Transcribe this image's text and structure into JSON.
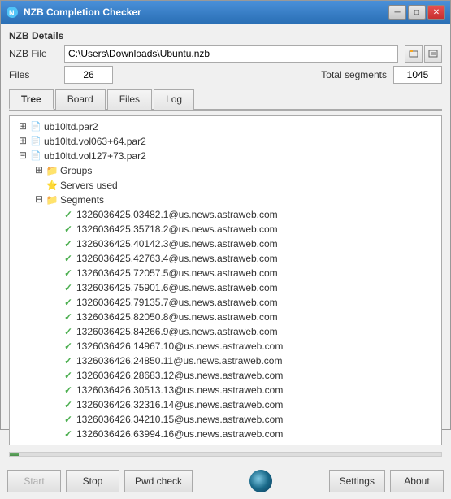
{
  "window": {
    "title": "NZB Completion Checker",
    "title_buttons": {
      "minimize": "─",
      "maximize": "□",
      "close": "✕"
    }
  },
  "details": {
    "section_label": "NZB Details",
    "nzb_file_label": "NZB File",
    "nzb_file_value": "C:\\Users\\Downloads\\Ubuntu.nzb",
    "files_label": "Files",
    "files_value": "26",
    "segments_label": "Total segments",
    "segments_value": "1045"
  },
  "tabs": [
    {
      "id": "tree",
      "label": "Tree",
      "active": true
    },
    {
      "id": "board",
      "label": "Board",
      "active": false
    },
    {
      "id": "files",
      "label": "Files",
      "active": false
    },
    {
      "id": "log",
      "label": "Log",
      "active": false
    }
  ],
  "tree": {
    "items": [
      {
        "indent": 0,
        "toggle": "⊞",
        "icon": "📄",
        "icon_type": "file",
        "text": "ub10ltd.par2"
      },
      {
        "indent": 0,
        "toggle": "⊞",
        "icon": "📄",
        "icon_type": "file",
        "text": "ub10ltd.vol063+64.par2"
      },
      {
        "indent": 0,
        "toggle": "⊟",
        "icon": "📄",
        "icon_type": "file",
        "text": "ub10ltd.vol127+73.par2"
      },
      {
        "indent": 1,
        "toggle": "⊞",
        "icon": "📁",
        "icon_type": "folder",
        "text": "Groups"
      },
      {
        "indent": 1,
        "toggle": null,
        "icon": "⭐",
        "icon_type": "star",
        "text": "Servers used"
      },
      {
        "indent": 1,
        "toggle": "⊟",
        "icon": "📁",
        "icon_type": "folder",
        "text": "Segments"
      },
      {
        "indent": 2,
        "toggle": null,
        "icon": "✔",
        "icon_type": "check",
        "text": "1326036425.03482.1@us.news.astraweb.com"
      },
      {
        "indent": 2,
        "toggle": null,
        "icon": "✔",
        "icon_type": "check",
        "text": "1326036425.35718.2@us.news.astraweb.com"
      },
      {
        "indent": 2,
        "toggle": null,
        "icon": "✔",
        "icon_type": "check",
        "text": "1326036425.40142.3@us.news.astraweb.com"
      },
      {
        "indent": 2,
        "toggle": null,
        "icon": "✔",
        "icon_type": "check",
        "text": "1326036425.42763.4@us.news.astraweb.com"
      },
      {
        "indent": 2,
        "toggle": null,
        "icon": "✔",
        "icon_type": "check",
        "text": "1326036425.72057.5@us.news.astraweb.com"
      },
      {
        "indent": 2,
        "toggle": null,
        "icon": "✔",
        "icon_type": "check",
        "text": "1326036425.75901.6@us.news.astraweb.com"
      },
      {
        "indent": 2,
        "toggle": null,
        "icon": "✔",
        "icon_type": "check",
        "text": "1326036425.79135.7@us.news.astraweb.com"
      },
      {
        "indent": 2,
        "toggle": null,
        "icon": "✔",
        "icon_type": "check",
        "text": "1326036425.82050.8@us.news.astraweb.com"
      },
      {
        "indent": 2,
        "toggle": null,
        "icon": "✔",
        "icon_type": "check",
        "text": "1326036425.84266.9@us.news.astraweb.com"
      },
      {
        "indent": 2,
        "toggle": null,
        "icon": "✔",
        "icon_type": "check",
        "text": "1326036426.14967.10@us.news.astraweb.com"
      },
      {
        "indent": 2,
        "toggle": null,
        "icon": "✔",
        "icon_type": "check",
        "text": "1326036426.24850.11@us.news.astraweb.com"
      },
      {
        "indent": 2,
        "toggle": null,
        "icon": "✔",
        "icon_type": "check",
        "text": "1326036426.28683.12@us.news.astraweb.com"
      },
      {
        "indent": 2,
        "toggle": null,
        "icon": "✔",
        "icon_type": "check",
        "text": "1326036426.30513.13@us.news.astraweb.com"
      },
      {
        "indent": 2,
        "toggle": null,
        "icon": "✔",
        "icon_type": "check",
        "text": "1326036426.32316.14@us.news.astraweb.com"
      },
      {
        "indent": 2,
        "toggle": null,
        "icon": "✔",
        "icon_type": "check",
        "text": "1326036426.34210.15@us.news.astraweb.com"
      },
      {
        "indent": 2,
        "toggle": null,
        "icon": "✔",
        "icon_type": "check",
        "text": "1326036426.63994.16@us.news.astraweb.com"
      }
    ]
  },
  "buttons": {
    "start": "Start",
    "stop": "Stop",
    "pwd_check": "Pwd check",
    "settings": "Settings",
    "about": "About"
  },
  "progress": {
    "value": 2
  }
}
